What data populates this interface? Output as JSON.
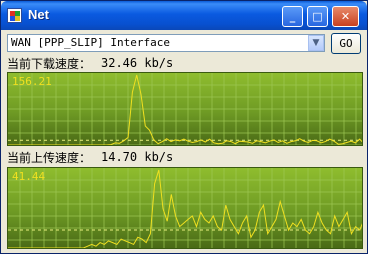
{
  "window": {
    "title": "Net"
  },
  "titlebar": {
    "minimize": "_",
    "maximize": "□",
    "close": "✕"
  },
  "interface": {
    "selected": "WAN [PPP_SLIP] Interface",
    "go_label": "GO"
  },
  "download": {
    "label": "当前下载速度：",
    "value": "32.46 kb/s",
    "max_label": "156.21",
    "series": [
      0,
      0,
      0,
      0,
      0,
      0,
      0,
      0,
      0,
      0,
      0,
      0,
      0,
      0,
      0,
      0,
      0,
      0,
      0,
      0,
      0,
      0,
      0,
      0,
      1,
      5,
      4,
      10,
      18,
      125,
      168,
      120,
      45,
      35,
      12,
      3,
      8,
      15,
      8,
      12,
      10,
      14,
      9,
      6,
      8,
      12,
      7,
      14,
      5,
      3,
      4,
      10,
      8,
      3,
      9,
      8,
      7,
      4,
      10,
      8,
      5,
      9,
      12,
      6,
      10,
      4,
      8,
      10,
      15,
      9,
      6,
      11,
      10,
      5,
      8,
      14,
      9,
      2,
      3,
      6,
      9,
      5,
      14,
      3
    ]
  },
  "upload": {
    "label": "当前上传速度：",
    "value": "14.70 kb/s",
    "max_label": "41.44",
    "series": [
      0,
      0,
      0,
      0,
      0,
      0,
      0,
      0,
      0,
      0,
      0,
      0,
      0,
      0,
      0,
      0,
      0,
      0,
      0,
      1,
      2,
      1,
      3,
      2,
      4,
      3,
      2,
      5,
      4,
      3,
      2,
      6,
      5,
      3,
      8,
      36,
      52,
      22,
      15,
      30,
      18,
      12,
      14,
      16,
      18,
      12,
      20,
      16,
      14,
      18,
      12,
      10,
      24,
      16,
      12,
      8,
      14,
      18,
      6,
      10,
      20,
      24,
      8,
      12,
      16,
      26,
      18,
      10,
      14,
      12,
      16,
      10,
      8,
      12,
      20,
      14,
      10,
      8,
      18,
      12,
      16,
      20,
      8,
      12,
      10,
      16
    ]
  },
  "colors": {
    "plot_line": "#f0e020",
    "grid": "#9ec854",
    "avg_line": "#e8f080"
  }
}
